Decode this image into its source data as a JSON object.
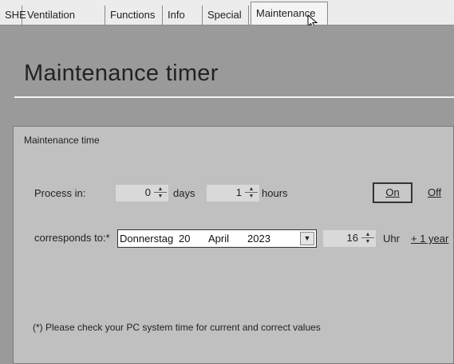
{
  "tabs": [
    {
      "label": "SHE"
    },
    {
      "label": "Ventilation"
    },
    {
      "label": "Functions"
    },
    {
      "label": "Info"
    },
    {
      "label": "Special"
    },
    {
      "label": "Maintenance"
    }
  ],
  "active_tab": "Maintenance",
  "page_title": "Maintenance timer",
  "group": {
    "title": "Maintenance time",
    "process_label": "Process in:",
    "days_value": "0",
    "days_unit": "days",
    "hours_value": "1",
    "hours_unit": "hours",
    "on_label": "On",
    "off_label": "Off",
    "corresponds_label": "corresponds to:*",
    "date": {
      "weekday": "Donnerstag",
      "day": "20",
      "month": "April",
      "year": "2023"
    },
    "hour_value": "16",
    "hour_unit": "Uhr",
    "plus_year_label": "+ 1 year",
    "note": "(*) Please check your PC system time for current and correct values"
  }
}
